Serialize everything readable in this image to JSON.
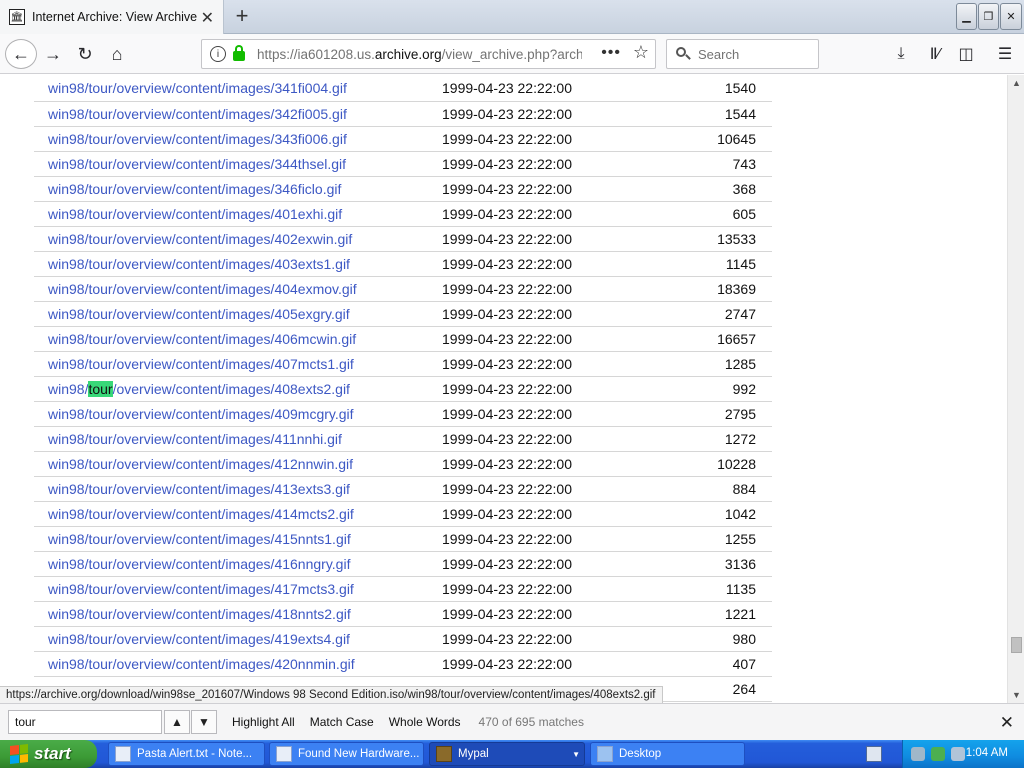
{
  "window": {
    "tab_title": "Internet Archive: View Archive",
    "new_tab_label": "+"
  },
  "nav": {
    "url_prefix": "https://ia601208.us.",
    "url_domain": "archive.org",
    "url_suffix": "/view_archive.php?arch",
    "search_placeholder": "Search"
  },
  "files": {
    "rows": [
      {
        "name": "win98/tour/overview/content/images/341fi004.gif",
        "date": "1999-04-23 22:22:00",
        "size": "1540"
      },
      {
        "name": "win98/tour/overview/content/images/342fi005.gif",
        "date": "1999-04-23 22:22:00",
        "size": "1544"
      },
      {
        "name": "win98/tour/overview/content/images/343fi006.gif",
        "date": "1999-04-23 22:22:00",
        "size": "10645"
      },
      {
        "name": "win98/tour/overview/content/images/344thsel.gif",
        "date": "1999-04-23 22:22:00",
        "size": "743"
      },
      {
        "name": "win98/tour/overview/content/images/346ficlo.gif",
        "date": "1999-04-23 22:22:00",
        "size": "368"
      },
      {
        "name": "win98/tour/overview/content/images/401exhi.gif",
        "date": "1999-04-23 22:22:00",
        "size": "605"
      },
      {
        "name": "win98/tour/overview/content/images/402exwin.gif",
        "date": "1999-04-23 22:22:00",
        "size": "13533"
      },
      {
        "name": "win98/tour/overview/content/images/403exts1.gif",
        "date": "1999-04-23 22:22:00",
        "size": "1145"
      },
      {
        "name": "win98/tour/overview/content/images/404exmov.gif",
        "date": "1999-04-23 22:22:00",
        "size": "18369"
      },
      {
        "name": "win98/tour/overview/content/images/405exgry.gif",
        "date": "1999-04-23 22:22:00",
        "size": "2747"
      },
      {
        "name": "win98/tour/overview/content/images/406mcwin.gif",
        "date": "1999-04-23 22:22:00",
        "size": "16657"
      },
      {
        "name": "win98/tour/overview/content/images/407mcts1.gif",
        "date": "1999-04-23 22:22:00",
        "size": "1285"
      },
      {
        "name": "win98/tour/overview/content/images/408exts2.gif",
        "date": "1999-04-23 22:22:00",
        "size": "992",
        "highlight": true
      },
      {
        "name": "win98/tour/overview/content/images/409mcgry.gif",
        "date": "1999-04-23 22:22:00",
        "size": "2795"
      },
      {
        "name": "win98/tour/overview/content/images/411nnhi.gif",
        "date": "1999-04-23 22:22:00",
        "size": "1272"
      },
      {
        "name": "win98/tour/overview/content/images/412nnwin.gif",
        "date": "1999-04-23 22:22:00",
        "size": "10228"
      },
      {
        "name": "win98/tour/overview/content/images/413exts3.gif",
        "date": "1999-04-23 22:22:00",
        "size": "884"
      },
      {
        "name": "win98/tour/overview/content/images/414mcts2.gif",
        "date": "1999-04-23 22:22:00",
        "size": "1042"
      },
      {
        "name": "win98/tour/overview/content/images/415nnts1.gif",
        "date": "1999-04-23 22:22:00",
        "size": "1255"
      },
      {
        "name": "win98/tour/overview/content/images/416nngry.gif",
        "date": "1999-04-23 22:22:00",
        "size": "3136"
      },
      {
        "name": "win98/tour/overview/content/images/417mcts3.gif",
        "date": "1999-04-23 22:22:00",
        "size": "1135"
      },
      {
        "name": "win98/tour/overview/content/images/418nnts2.gif",
        "date": "1999-04-23 22:22:00",
        "size": "1221"
      },
      {
        "name": "win98/tour/overview/content/images/419exts4.gif",
        "date": "1999-04-23 22:22:00",
        "size": "980"
      },
      {
        "name": "win98/tour/overview/content/images/420nnmin.gif",
        "date": "1999-04-23 22:22:00",
        "size": "407"
      },
      {
        "name": "",
        "date": "",
        "size": "264"
      }
    ]
  },
  "status_url": "https://archive.org/download/win98se_201607/Windows 98 Second Edition.iso/win98/tour/overview/content/images/408exts2.gif",
  "findbar": {
    "query": "tour",
    "highlight_all": "Highlight All",
    "match_case": "Match Case",
    "whole_words": "Whole Words",
    "count": "470 of 695 matches"
  },
  "taskbar": {
    "start_label": "start",
    "tasks": [
      {
        "label": "Pasta Alert.txt - Note..."
      },
      {
        "label": "Found New Hardware..."
      },
      {
        "label": "Mypal"
      },
      {
        "label": "Desktop"
      }
    ],
    "clock": "1:04 AM"
  },
  "colors": {
    "link": "#3d58c4",
    "find_highlight": "#38d878",
    "taskbar": "#245edb",
    "start": "#3c9b36"
  }
}
